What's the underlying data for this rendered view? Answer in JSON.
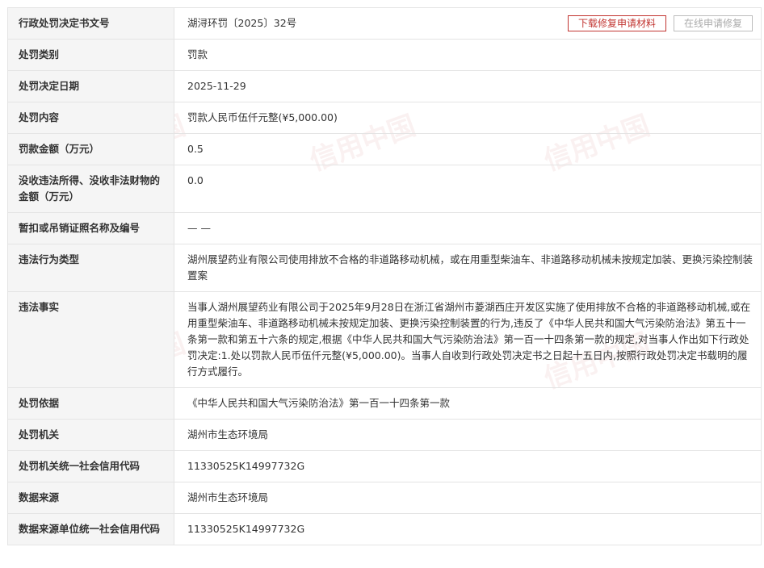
{
  "actions": {
    "download_label": "下载修复申请材料",
    "online_label": "在线申请修复"
  },
  "rows": [
    {
      "label": "行政处罚决定书文号",
      "value": "湖浔环罚〔2025〕32号"
    },
    {
      "label": "处罚类别",
      "value": "罚款"
    },
    {
      "label": "处罚决定日期",
      "value": "2025-11-29"
    },
    {
      "label": "处罚内容",
      "value": "罚款人民币伍仟元整(¥5,000.00)"
    },
    {
      "label": "罚款金额（万元）",
      "value": "0.5"
    },
    {
      "label": "没收违法所得、没收非法财物的金额（万元）",
      "value": "0.0"
    },
    {
      "label": "暂扣或吊销证照名称及编号",
      "value": "— —"
    },
    {
      "label": "违法行为类型",
      "value": "湖州展望药业有限公司使用排放不合格的非道路移动机械，或在用重型柴油车、非道路移动机械未按规定加装、更换污染控制装置案"
    },
    {
      "label": "违法事实",
      "value": "当事人湖州展望药业有限公司于2025年9月28日在浙江省湖州市菱湖西庄开发区实施了使用排放不合格的非道路移动机械,或在用重型柴油车、非道路移动机械未按规定加装、更换污染控制装置的行为,违反了《中华人民共和国大气污染防治法》第五十一条第一款和第五十六条的规定,根据《中华人民共和国大气污染防治法》第一百一十四条第一款的规定,对当事人作出如下行政处罚决定:1.处以罚款人民币伍仟元整(¥5,000.00)。当事人自收到行政处罚决定书之日起十五日内,按照行政处罚决定书载明的履行方式履行。"
    },
    {
      "label": "处罚依据",
      "value": "《中华人民共和国大气污染防治法》第一百一十四条第一款"
    },
    {
      "label": "处罚机关",
      "value": "湖州市生态环境局"
    },
    {
      "label": "处罚机关统一社会信用代码",
      "value": "11330525K14997732G"
    },
    {
      "label": "数据来源",
      "value": "湖州市生态环境局"
    },
    {
      "label": "数据来源单位统一社会信用代码",
      "value": "11330525K14997732G"
    }
  ],
  "watermark": {
    "text": "信用中国"
  }
}
